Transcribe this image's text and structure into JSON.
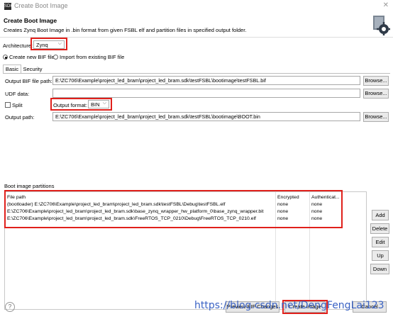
{
  "window": {
    "title": "Create Boot Image",
    "app_icon_text": "SDK",
    "close_symbol": "✕"
  },
  "header": {
    "title": "Create Boot Image",
    "description": "Creates Zynq Boot Image in .bin format from given FSBL elf and partition files in specified output folder."
  },
  "architecture": {
    "label": "Architecture:",
    "value": "Zynq"
  },
  "bif_mode": {
    "options": [
      {
        "label": "Create new BIF file",
        "selected": true
      },
      {
        "label": "Import from existing BIF file",
        "selected": false
      }
    ]
  },
  "tabs": [
    {
      "label": "Basic",
      "active": true
    },
    {
      "label": "Security",
      "active": false
    }
  ],
  "form": {
    "output_bif": {
      "label": "Output BIF file path:",
      "value": "E:\\ZC706\\Example\\project_led_bram\\project_led_bram.sdk\\testFSBL\\bootimage\\testFSBL.bif",
      "button": "Browse..."
    },
    "udf_data": {
      "label": "UDF data:",
      "value": "",
      "button": "Browse..."
    },
    "split": {
      "label": "Split",
      "checked": false
    },
    "output_format": {
      "label": "Output format:",
      "value": "BIN"
    },
    "output_path": {
      "label": "Output path:",
      "value": "E:\\ZC706\\Example\\project_led_bram\\project_led_bram.sdk\\testFSBL\\bootimage\\BOOT.bin",
      "button": "Browse..."
    }
  },
  "partitions": {
    "label": "Boot image partitions",
    "columns": [
      "File path",
      "Encrypted",
      "Authenticat..."
    ],
    "rows": [
      [
        "(bootloader) E:\\ZC706\\Example\\project_led_bram\\project_led_bram.sdk\\testFSBL\\Debug\\testFSBL.elf",
        "none",
        "none"
      ],
      [
        "E:\\ZC706\\Example\\project_led_bram\\project_led_bram.sdk\\base_zynq_wrapper_hw_platform_0\\base_zynq_wrapper.bit",
        "none",
        "none"
      ],
      [
        "E:\\ZC706\\Example\\project_led_bram\\project_led_bram.sdk\\FreeRTOS_TCP_0210\\Debug\\FreeRTOS_TCP_0210.elf",
        "none",
        "none"
      ]
    ],
    "buttons": {
      "add": "Add",
      "delete": "Delete",
      "edit": "Edit",
      "up": "Up",
      "down": "Down"
    }
  },
  "footer": {
    "help_symbol": "?",
    "preview_label": "Preview BIF Changes",
    "create_label": "Create Image",
    "cancel_label": "Cancel",
    "watermark": "https://blog.csdn.net/DengFengLai123"
  },
  "colors": {
    "highlight_red": "#e0201b",
    "watermark_blue": "#3b63c4"
  }
}
